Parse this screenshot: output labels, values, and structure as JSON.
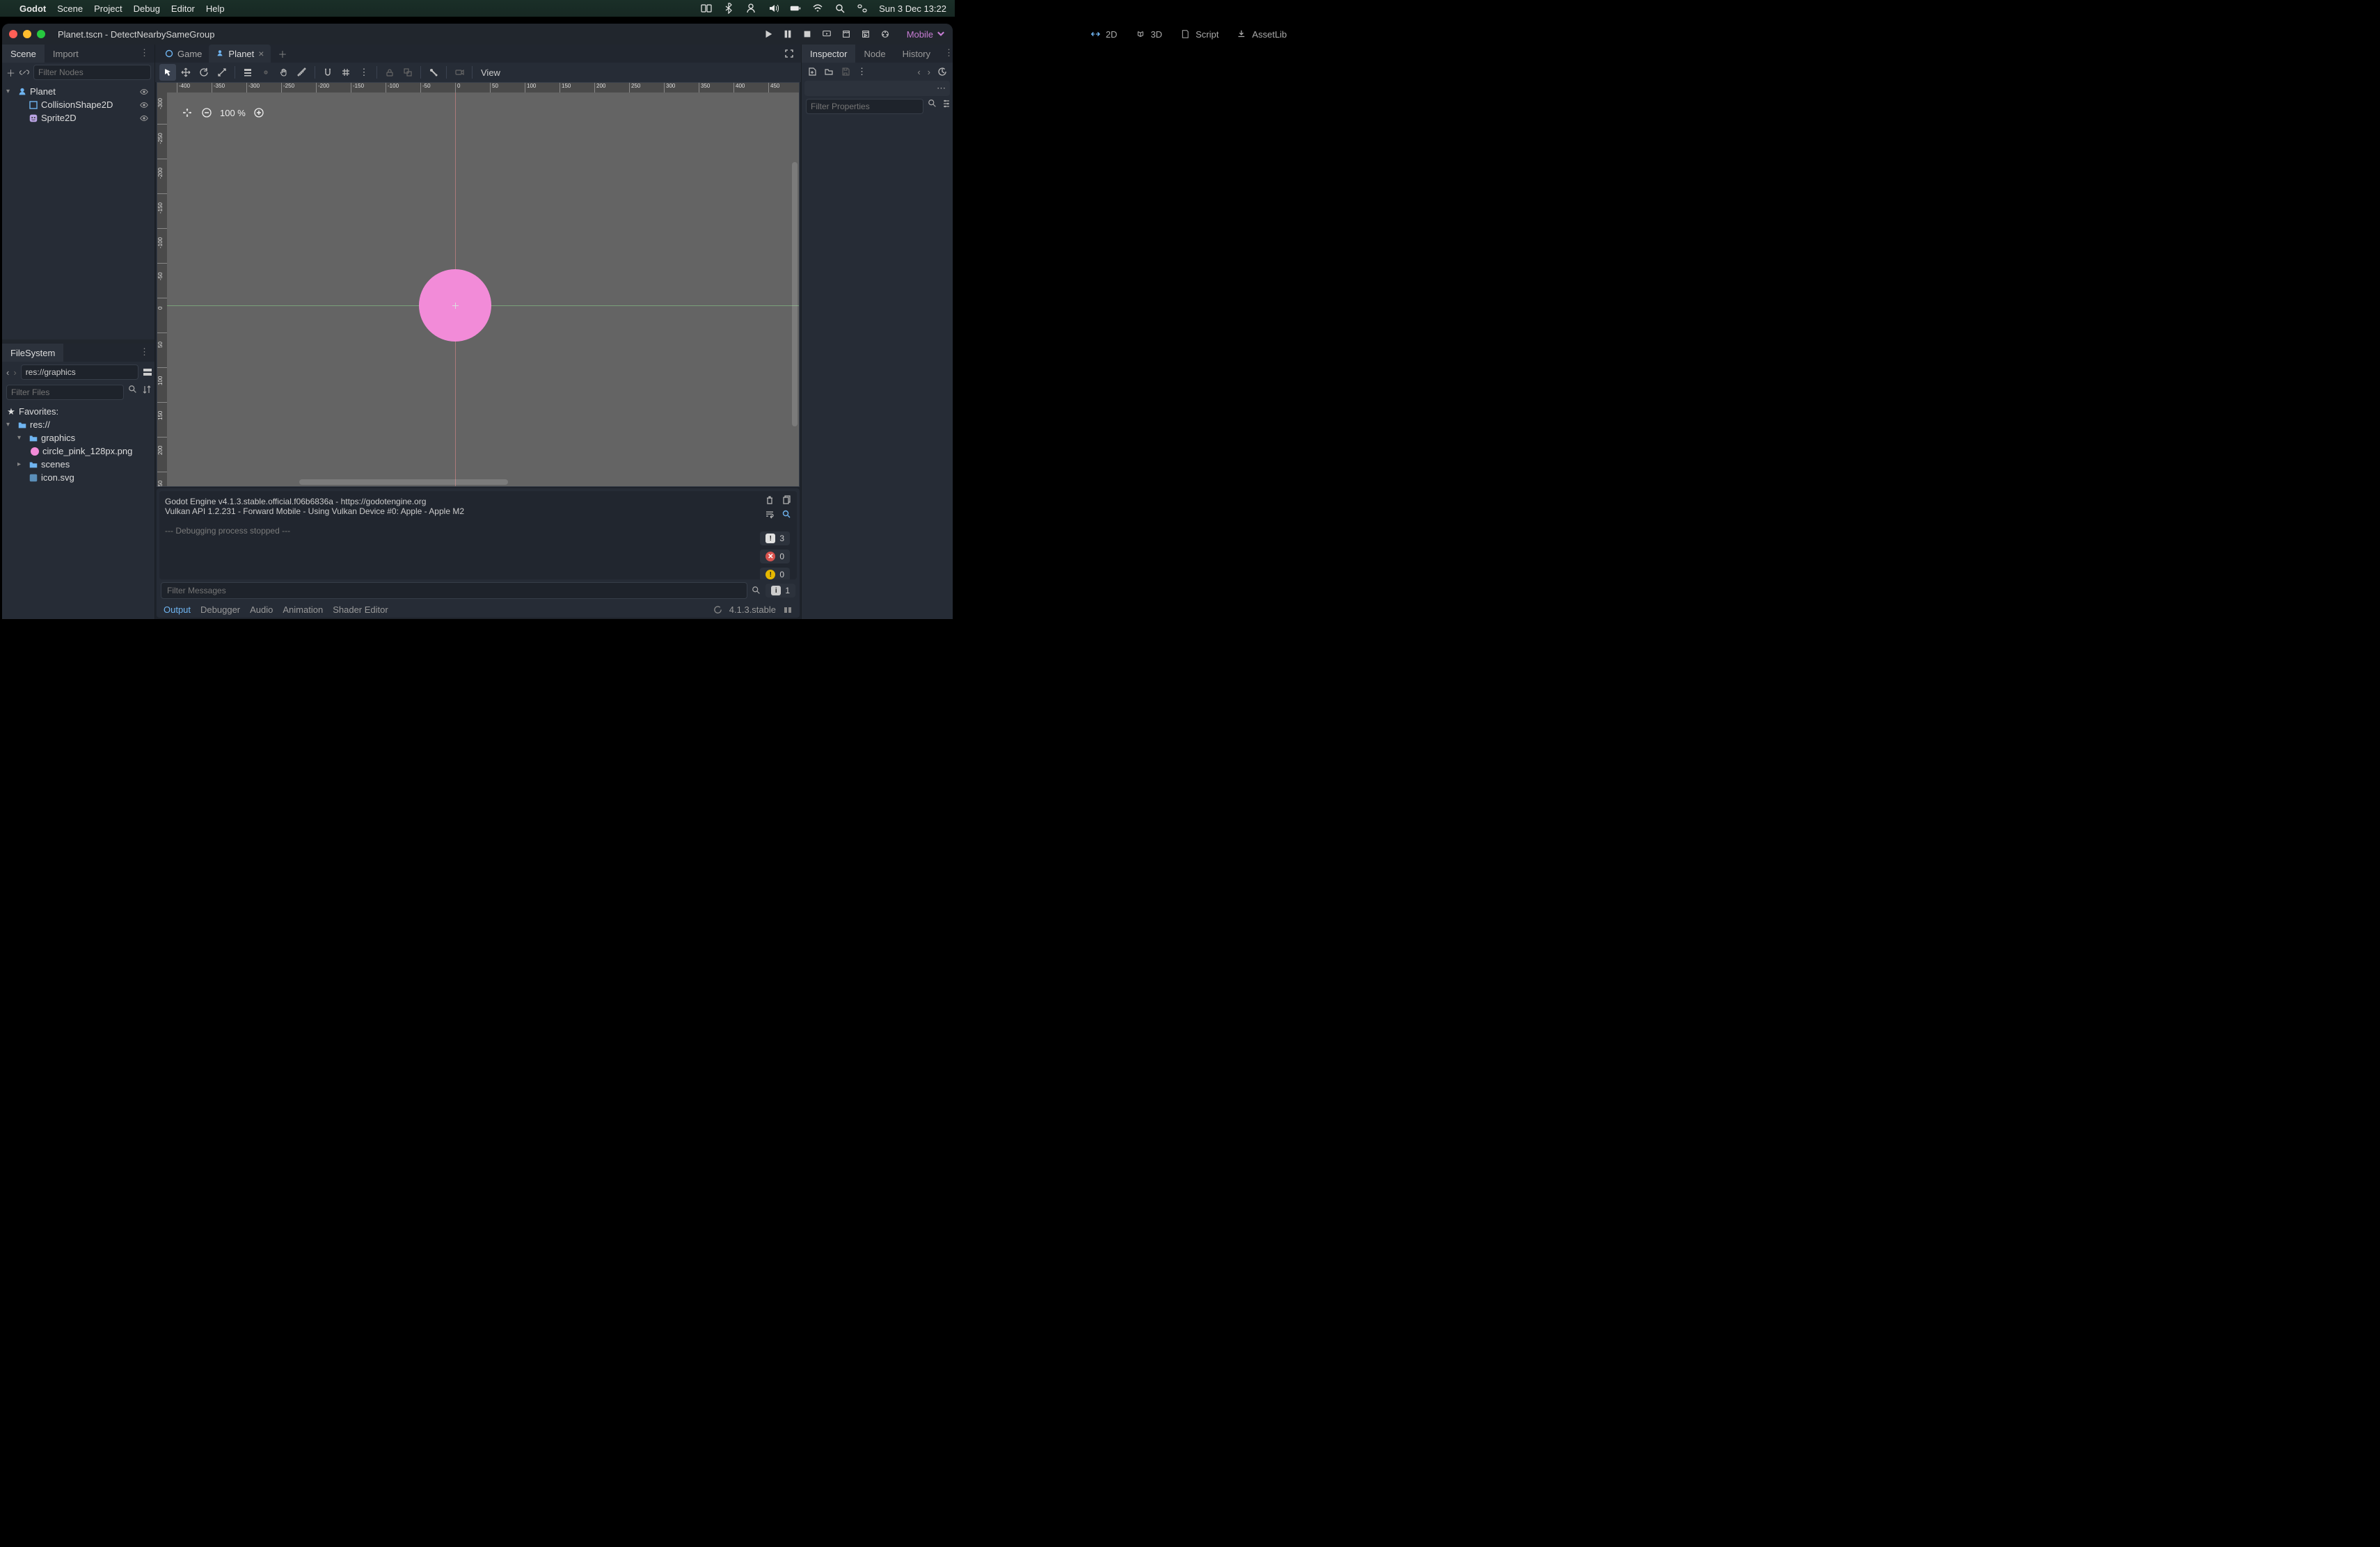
{
  "os_menu": {
    "app": "Godot",
    "items": [
      "Scene",
      "Project",
      "Debug",
      "Editor",
      "Help"
    ],
    "clock": "Sun 3 Dec  13:22"
  },
  "window": {
    "title": "Planet.tscn - DetectNearbySameGroup",
    "viewmodes": {
      "d2": "2D",
      "d3": "3D",
      "script": "Script",
      "assetlib": "AssetLib"
    },
    "renderer": "Mobile"
  },
  "scene_dock": {
    "tabs": {
      "scene": "Scene",
      "import": "Import"
    },
    "filter_placeholder": "Filter Nodes",
    "root": "Planet",
    "children": [
      {
        "name": "CollisionShape2D",
        "icon": "collision"
      },
      {
        "name": "Sprite2D",
        "icon": "sprite"
      }
    ]
  },
  "fs_dock": {
    "title": "FileSystem",
    "path": "res://graphics",
    "filter_placeholder": "Filter Files",
    "favorites": "Favorites:",
    "root": "res://",
    "items": {
      "graphics": "graphics",
      "circle_file": "circle_pink_128px.png",
      "scenes": "scenes",
      "icon_svg": "icon.svg"
    }
  },
  "scene_tabs": {
    "game": "Game",
    "planet": "Planet"
  },
  "canvas_toolbar": {
    "view": "View"
  },
  "viewport": {
    "zoom": "100 %"
  },
  "console": {
    "line1": "Godot Engine v4.1.3.stable.official.f06b6836a - https://godotengine.org",
    "line2": "Vulkan API 1.2.231 - Forward Mobile - Using Vulkan Device #0: Apple - Apple M2",
    "line3": "--- Debugging process stopped ---",
    "filter_placeholder": "Filter Messages",
    "counts": {
      "errors": "3",
      "critical": "0",
      "warnings": "0",
      "last": "1"
    }
  },
  "bottom_tabs": {
    "output": "Output",
    "debugger": "Debugger",
    "audio": "Audio",
    "animation": "Animation",
    "shader": "Shader Editor",
    "version": "4.1.3.stable"
  },
  "inspector": {
    "tabs": {
      "inspector": "Inspector",
      "node": "Node",
      "history": "History"
    },
    "filter_placeholder": "Filter Properties"
  }
}
